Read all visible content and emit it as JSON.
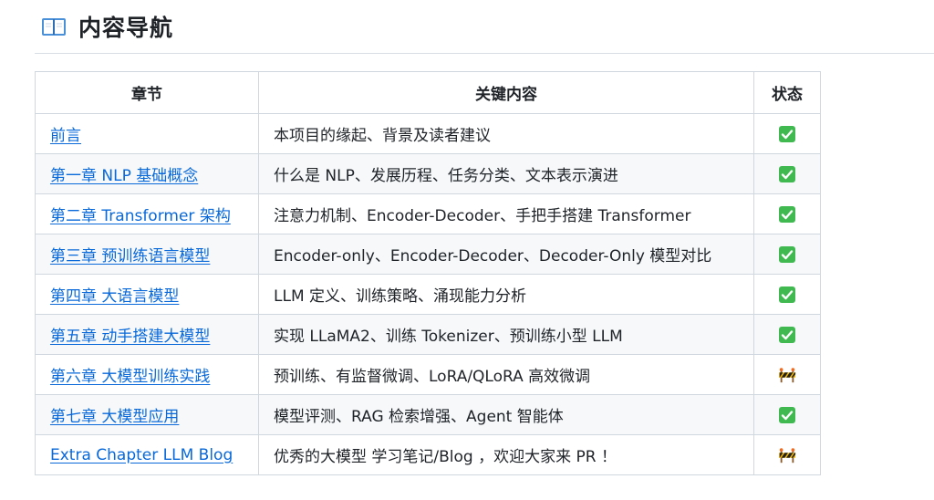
{
  "heading": {
    "icon": "open-book-icon",
    "title": "内容导航"
  },
  "table": {
    "headers": [
      "章节",
      "关键内容",
      "状态"
    ],
    "rows": [
      {
        "chapter": "前言",
        "content": "本项目的缘起、背景及读者建议",
        "status": "done"
      },
      {
        "chapter": "第一章 NLP 基础概念",
        "content": "什么是 NLP、发展历程、任务分类、文本表示演进",
        "status": "done"
      },
      {
        "chapter": "第二章 Transformer 架构",
        "content": "注意力机制、Encoder-Decoder、手把手搭建 Transformer",
        "status": "done"
      },
      {
        "chapter": "第三章 预训练语言模型",
        "content": "Encoder-only、Encoder-Decoder、Decoder-Only 模型对比",
        "status": "done"
      },
      {
        "chapter": "第四章 大语言模型",
        "content": "LLM 定义、训练策略、涌现能力分析",
        "status": "done"
      },
      {
        "chapter": "第五章 动手搭建大模型",
        "content": "实现 LLaMA2、训练 Tokenizer、预训练小型 LLM",
        "status": "done"
      },
      {
        "chapter": "第六章 大模型训练实践",
        "content": "预训练、有监督微调、LoRA/QLoRA 高效微调",
        "status": "construction"
      },
      {
        "chapter": "第七章 大模型应用",
        "content": "模型评测、RAG 检索增强、Agent 智能体",
        "status": "done"
      },
      {
        "chapter": "Extra Chapter LLM Blog",
        "content": "优秀的大模型 学习笔记/Blog ，欢迎大家来 PR ！",
        "status": "construction"
      }
    ]
  },
  "colors": {
    "link": "#0969da",
    "check_bg": "#3fb950",
    "border": "#d0d7de",
    "stripe": "#f6f8fa"
  }
}
